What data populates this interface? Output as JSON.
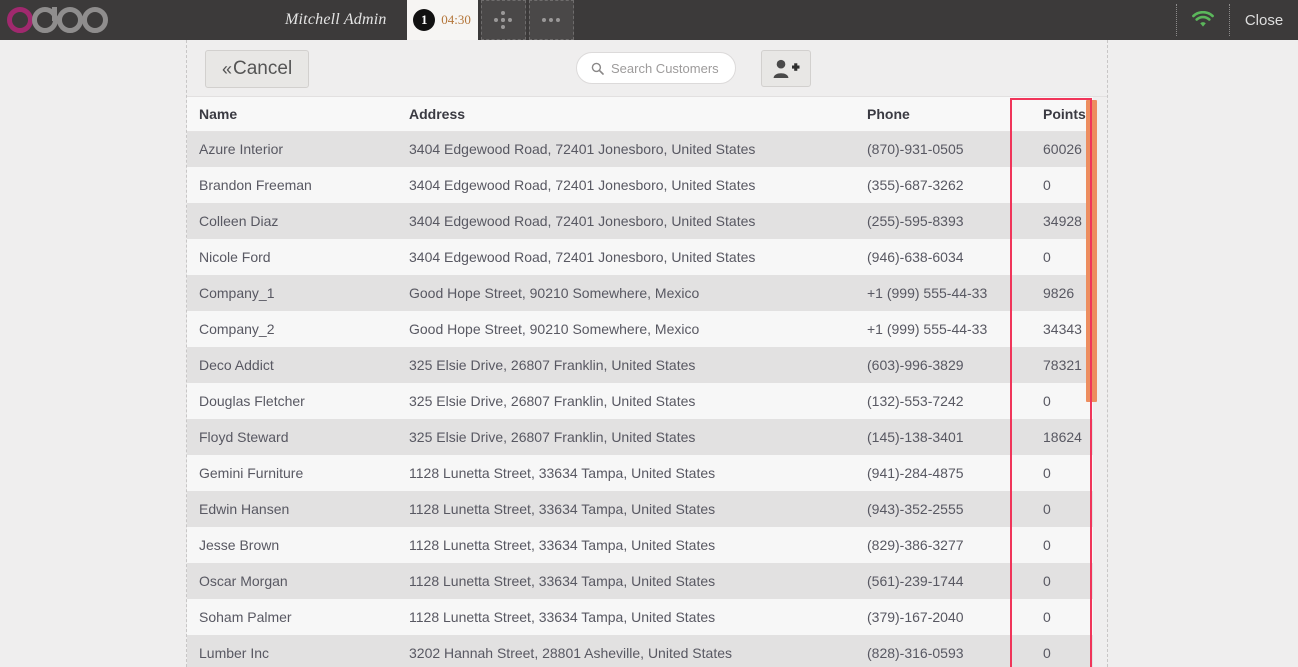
{
  "topbar": {
    "logo_text": "odoo",
    "logo_accent_color": "#a0296e",
    "logo_gray_color": "#8f8d8d",
    "username": "Mitchell Admin",
    "order_tab": {
      "badge": "1",
      "time": "04:30"
    },
    "add_order_icon": "plus-icon",
    "remove_order_icon": "minus-icon",
    "wifi_icon": "wifi-icon",
    "wifi_color": "#5bb75b",
    "close_label": "Close"
  },
  "toolbar": {
    "cancel_chevron": "«",
    "cancel_label": "Cancel",
    "search_placeholder": "Search Customers",
    "search_value": "",
    "search_icon": "search-icon",
    "add_customer_icon": "user-plus-icon"
  },
  "table": {
    "columns": [
      "Name",
      "Address",
      "Phone",
      "Points"
    ],
    "highlight_column": "Points",
    "highlight_color": "#f0355a",
    "rows": [
      {
        "name": "Azure Interior",
        "address": "3404 Edgewood Road, 72401 Jonesboro, United States",
        "phone": "(870)-931-0505",
        "points": "60026"
      },
      {
        "name": "Brandon Freeman",
        "address": "3404 Edgewood Road, 72401 Jonesboro, United States",
        "phone": "(355)-687-3262",
        "points": "0"
      },
      {
        "name": "Colleen Diaz",
        "address": "3404 Edgewood Road, 72401 Jonesboro, United States",
        "phone": "(255)-595-8393",
        "points": "34928"
      },
      {
        "name": "Nicole Ford",
        "address": "3404 Edgewood Road, 72401 Jonesboro, United States",
        "phone": "(946)-638-6034",
        "points": "0"
      },
      {
        "name": "Company_1",
        "address": "Good Hope Street, 90210 Somewhere, Mexico",
        "phone": "+1 (999) 555-44-33",
        "points": "9826"
      },
      {
        "name": "Company_2",
        "address": "Good Hope Street, 90210 Somewhere, Mexico",
        "phone": "+1 (999) 555-44-33",
        "points": "34343"
      },
      {
        "name": "Deco Addict",
        "address": "325 Elsie Drive, 26807 Franklin, United States",
        "phone": "(603)-996-3829",
        "points": "78321"
      },
      {
        "name": "Douglas Fletcher",
        "address": "325 Elsie Drive, 26807 Franklin, United States",
        "phone": "(132)-553-7242",
        "points": "0"
      },
      {
        "name": "Floyd Steward",
        "address": "325 Elsie Drive, 26807 Franklin, United States",
        "phone": "(145)-138-3401",
        "points": "18624"
      },
      {
        "name": "Gemini Furniture",
        "address": "1128 Lunetta Street, 33634 Tampa, United States",
        "phone": "(941)-284-4875",
        "points": "0"
      },
      {
        "name": "Edwin Hansen",
        "address": "1128 Lunetta Street, 33634 Tampa, United States",
        "phone": "(943)-352-2555",
        "points": "0"
      },
      {
        "name": "Jesse Brown",
        "address": "1128 Lunetta Street, 33634 Tampa, United States",
        "phone": "(829)-386-3277",
        "points": "0"
      },
      {
        "name": "Oscar Morgan",
        "address": "1128 Lunetta Street, 33634 Tampa, United States",
        "phone": "(561)-239-1744",
        "points": "0"
      },
      {
        "name": "Soham Palmer",
        "address": "1128 Lunetta Street, 33634 Tampa, United States",
        "phone": "(379)-167-2040",
        "points": "0"
      },
      {
        "name": "Lumber Inc",
        "address": "3202 Hannah Street, 28801 Asheville, United States",
        "phone": "(828)-316-0593",
        "points": "0"
      }
    ]
  },
  "scrollbar": {
    "color": "#ed8d5f"
  }
}
